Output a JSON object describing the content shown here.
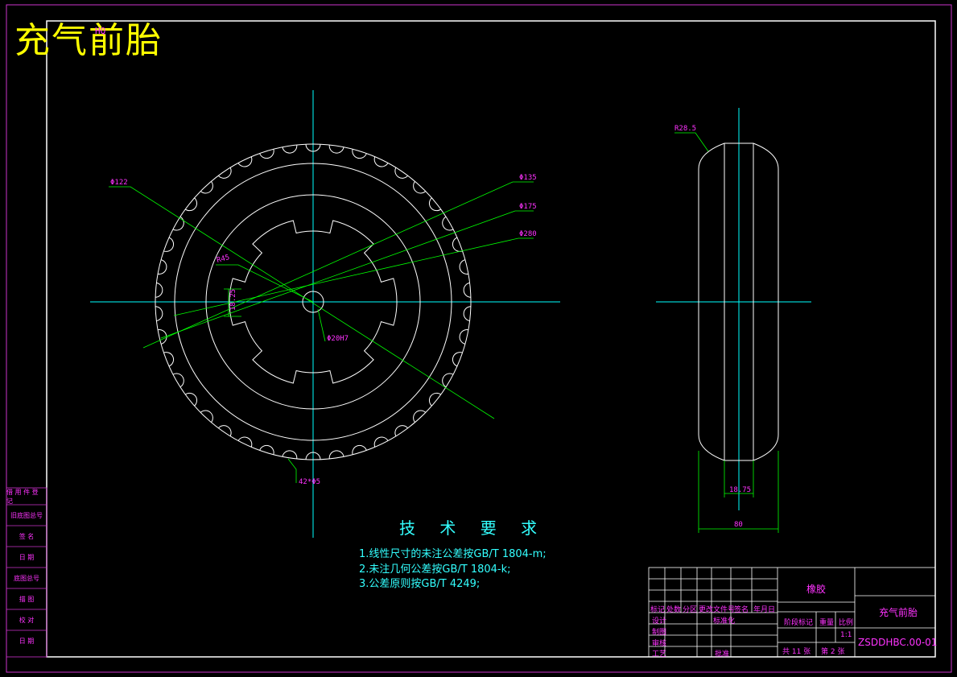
{
  "drawing": {
    "title_stamp": "充气前胎",
    "ghost_text": "HQ",
    "colors": {
      "background": "#000000",
      "frame": "#cc33cc",
      "geometry": "#ffffff",
      "centerline": "#00ffff",
      "dimension": "#00ff00",
      "dim_text": "#ff33ff",
      "note": "#33ffff",
      "title_yellow": "#ffff00"
    }
  },
  "front_view": {
    "dimensions": {
      "outer_dia": "Φ122",
      "d135": "Φ135",
      "d175": "Φ175",
      "d280": "Φ280",
      "radius_r45": "R45",
      "slot_width": "18.25",
      "bore": "Φ20H7",
      "groove_count": "42*Φ5"
    },
    "groove_count": 42
  },
  "side_view": {
    "dimensions": {
      "edge_radius": "R28.5",
      "inner_width": "18.75",
      "overall_width": "80"
    }
  },
  "technical_requirements": {
    "heading": "技 术 要 求",
    "notes": [
      "1.线性尺寸的未注公差按GB/T 1804-m;",
      "2.未注几何公差按GB/T 1804-k;",
      "3.公差原则按GB/T 4249;"
    ]
  },
  "side_stamp": {
    "labels": [
      "借 用 件 登 记",
      "旧底图总号",
      "签 名",
      "日 期",
      "底图总号",
      "描 图",
      "校 对",
      "日 期"
    ]
  },
  "title_block": {
    "material": "橡胶",
    "part_name": "充气前胎",
    "drawing_number": "ZSDDHBC.00-01",
    "scale_label": "比例",
    "scale_value": "1:1",
    "weight_label": "重量",
    "stage_label": "阶段标记",
    "sheets_total": "共 11 张",
    "sheet_no": "第 2 张",
    "header_row": [
      "标记",
      "处数",
      "分区",
      "更改文件号",
      "签名",
      "年月日"
    ],
    "left_rows": [
      "设计",
      "制图",
      "审核",
      "工艺"
    ],
    "standardize_label": "标准化",
    "approve_label": "批准"
  }
}
